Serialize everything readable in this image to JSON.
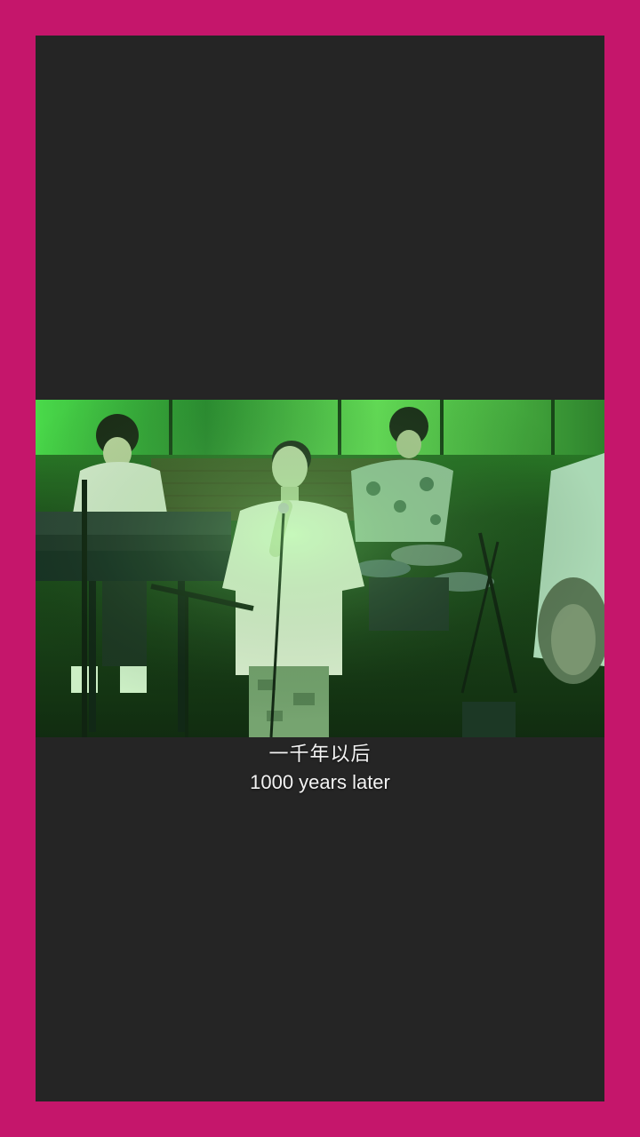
{
  "subtitles": {
    "chinese": "一千年以后",
    "english": "1000 years later"
  },
  "colors": {
    "border": "#c5166b",
    "background": "#252525",
    "stage_light": "#3fe04a"
  }
}
